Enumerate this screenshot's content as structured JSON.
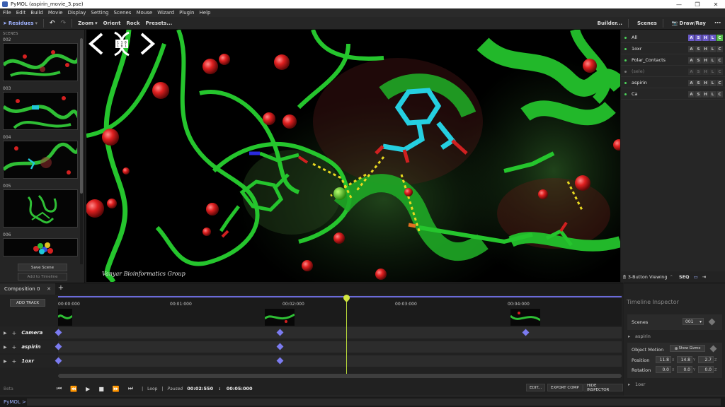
{
  "window": {
    "title": "PyMOL (aspirin_movie_3.pse)",
    "minimize": "—",
    "maximize": "❐",
    "close": "✕"
  },
  "menu": [
    "File",
    "Edit",
    "Build",
    "Movie",
    "Display",
    "Setting",
    "Scenes",
    "Mouse",
    "Wizard",
    "Plugin",
    "Help"
  ],
  "toolbar": {
    "residues": "Residues",
    "zoom": "Zoom",
    "orient": "Orient",
    "rock": "Rock",
    "presets": "Presets...",
    "builder": "Builder...",
    "scenes": "Scenes",
    "draw_ray": "Draw/Ray"
  },
  "scenes_panel": {
    "label": "SCENES",
    "scenes": [
      {
        "number": "002"
      },
      {
        "number": "003"
      },
      {
        "number": "004"
      },
      {
        "number": "005"
      },
      {
        "number": "006"
      }
    ],
    "save_scene": "Save Scene",
    "add_to_timeline": "Add to Timeline"
  },
  "viewport": {
    "watermark": "Vanyar Bioinformatics Group",
    "logo_badge": "1 1 0\n1 0 1"
  },
  "objects": [
    {
      "name": "All",
      "style": "all"
    },
    {
      "name": "1oxr",
      "style": "normal"
    },
    {
      "name": "Polar_Contacts",
      "style": "normal"
    },
    {
      "name": "(sele)",
      "style": "dim"
    },
    {
      "name": "aspirin",
      "style": "normal"
    },
    {
      "name": "Ca",
      "style": "normal"
    }
  ],
  "object_buttons": [
    "A",
    "S",
    "H",
    "L",
    "C"
  ],
  "objects_bottom": {
    "mode": "3-Button Viewing",
    "seq": "SEQ"
  },
  "timeline": {
    "composition_tab": "Composition 0",
    "add_track": "ADD TRACK",
    "ticks": [
      "00:00:000",
      "00:01:000",
      "00:02:000",
      "00:03:000",
      "00:04:000"
    ],
    "tracks": [
      {
        "name": "Camera",
        "keyframes": [
          0,
          2.0,
          4.1
        ]
      },
      {
        "name": "aspirin",
        "keyframes": [
          0,
          2.0
        ]
      },
      {
        "name": "1oxr",
        "keyframes": [
          0,
          2.0
        ]
      }
    ],
    "playhead_time": 2.55,
    "transport": {
      "beta": "Beta",
      "loop": "Loop",
      "status": "Paused",
      "current": "00:02:550",
      "separator": ":",
      "total": "00:05:000"
    },
    "buttons": {
      "edit": "EDIT...",
      "export": "EXPORT COMP",
      "hide": "HIDE INSPECTOR"
    }
  },
  "inspector": {
    "title": "Timeline Inspector",
    "scenes_label": "Scenes",
    "scenes_value": "001",
    "aspirin_section": "aspirin",
    "object_motion": "Object Motion",
    "show_gizmo": "Show Gizmo",
    "position_label": "Position",
    "position": {
      "x": "11.8",
      "y": "14.8",
      "z": "2.7"
    },
    "rotation_label": "Rotation",
    "rotation": {
      "x": "0.0",
      "y": "0.0",
      "z": "0.0"
    },
    "axes": {
      "x": "X",
      "y": "Y",
      "z": "Z"
    },
    "oxr_section": "1oxr"
  },
  "command": {
    "prompt": "PyMOL >",
    "value": ""
  },
  "colors": {
    "accent": "#6b6bd8",
    "keyframe": "#7b7bf0",
    "playhead": "#d3e640",
    "protein": "#22c22a",
    "ligand": "#20c8d8",
    "water": "#d42020"
  }
}
